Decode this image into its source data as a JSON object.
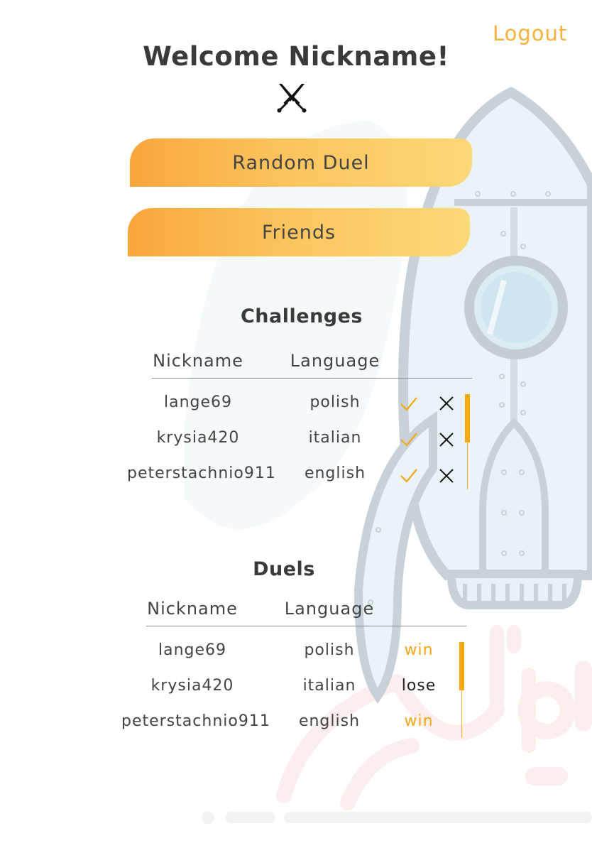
{
  "header": {
    "logout_label": "Logout",
    "welcome": "Welcome Nickname!",
    "emblem_icon": "crossed-swords-icon"
  },
  "actions": {
    "random_duel": "Random Duel",
    "friends": "Friends"
  },
  "challenges": {
    "title": "Challenges",
    "columns": [
      "Nickname",
      "Language"
    ],
    "rows": [
      {
        "nickname": "lange69",
        "language": "polish"
      },
      {
        "nickname": "krysia420",
        "language": "italian"
      },
      {
        "nickname": "peterstachnio911",
        "language": "english"
      }
    ],
    "accept_icon": "check-icon",
    "decline_icon": "close-icon"
  },
  "duels": {
    "title": "Duels",
    "columns": [
      "Nickname",
      "Language"
    ],
    "rows": [
      {
        "nickname": "lange69",
        "language": "polish",
        "result": "win"
      },
      {
        "nickname": "krysia420",
        "language": "italian",
        "result": "lose"
      },
      {
        "nickname": "peterstachnio911",
        "language": "english",
        "result": "win"
      }
    ]
  },
  "colors": {
    "accent": "#f6b23a",
    "button_gradient_start": "#f9a63c",
    "button_gradient_end": "#fbd878",
    "text": "#3a3a3a",
    "win": "#f3a717",
    "lose": "#222222"
  },
  "background_illustration": "rocket-illustration"
}
